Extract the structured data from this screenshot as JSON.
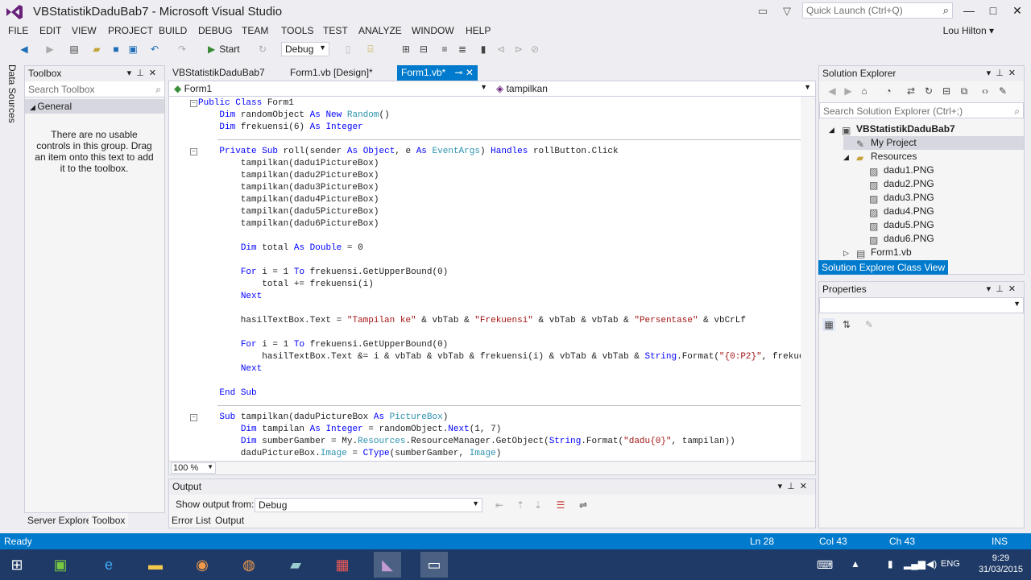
{
  "window": {
    "title": "VBStatistikDaduBab7 - Microsoft Visual Studio",
    "quick_launch_placeholder": "Quick Launch (Ctrl+Q)"
  },
  "menu": [
    "FILE",
    "EDIT",
    "VIEW",
    "PROJECT",
    "BUILD",
    "DEBUG",
    "TEAM",
    "TOOLS",
    "TEST",
    "ANALYZE",
    "WINDOW",
    "HELP"
  ],
  "user": "Lou Hilton",
  "toolbar": {
    "start_label": "Start",
    "config": "Debug"
  },
  "left_strip": {
    "data_sources": "Data Sources"
  },
  "toolbox": {
    "title": "Toolbox",
    "search_placeholder": "Search Toolbox",
    "group": "General",
    "empty_text": "There are no usable controls in this group. Drag an item onto this text to add it to the toolbox."
  },
  "left_bottom_tabs": [
    "Server Explorer",
    "Toolbox"
  ],
  "doc_tabs": [
    "VBStatistikDaduBab7",
    "Form1.vb [Design]*",
    "Form1.vb*"
  ],
  "editor": {
    "nav_left": "Form1",
    "nav_right": "tampilkan",
    "zoom": "100 %",
    "lines": [
      [
        "Public Class Form1"
      ],
      [
        "    Dim randomObject As New Random()"
      ],
      [
        "    Dim frekuensi(6) As Integer"
      ],
      [
        ""
      ],
      [
        "    Private Sub roll(sender As Object, e As EventArgs) Handles rollButton.Click"
      ],
      [
        "        tampilkan(dadu1PictureBox)"
      ],
      [
        "        tampilkan(dadu2PictureBox)"
      ],
      [
        "        tampilkan(dadu3PictureBox)"
      ],
      [
        "        tampilkan(dadu4PictureBox)"
      ],
      [
        "        tampilkan(dadu5PictureBox)"
      ],
      [
        "        tampilkan(dadu6PictureBox)"
      ],
      [
        ""
      ],
      [
        "        Dim total As Double = 0"
      ],
      [
        ""
      ],
      [
        "        For i = 1 To frekuensi.GetUpperBound(0)"
      ],
      [
        "            total += frekuensi(i)"
      ],
      [
        "        Next"
      ],
      [
        ""
      ],
      [
        "        hasilTextBox.Text = \"Tampilan ke\" & vbTab & \"Frekuensi\" & vbTab & vbTab & \"Persentase\" & vbCrLf"
      ],
      [
        ""
      ],
      [
        "        For i = 1 To frekuensi.GetUpperBound(0)"
      ],
      [
        "            hasilTextBox.Text &= i & vbTab & vbTab & frekuensi(i) & vbTab & vbTab & String.Format(\"{0:P2}\", frekue"
      ],
      [
        "        Next"
      ],
      [
        ""
      ],
      [
        "    End Sub"
      ],
      [
        ""
      ],
      [
        "    Sub tampilkan(daduPictureBox As PictureBox)"
      ],
      [
        "        Dim tampilan As Integer = randomObject.Next(1, 7)"
      ],
      [
        "        Dim sumberGamber = My.Resources.ResourceManager.GetObject(String.Format(\"dadu{0}\", tampilan))"
      ],
      [
        "        daduPictureBox.Image = CType(sumberGamber, Image)"
      ]
    ]
  },
  "output": {
    "title": "Output",
    "show_from_label": "Show output from:",
    "source": "Debug"
  },
  "center_bottom_tabs": [
    "Error List",
    "Output"
  ],
  "solution_explorer": {
    "title": "Solution Explorer",
    "search_placeholder": "Search Solution Explorer (Ctrl+;)",
    "items": [
      "VBStatistikDaduBab7",
      "My Project",
      "Resources",
      "dadu1.PNG",
      "dadu2.PNG",
      "dadu3.PNG",
      "dadu4.PNG",
      "dadu5.PNG",
      "dadu6.PNG",
      "Form1.vb"
    ]
  },
  "right_tabs": [
    "Solution Explorer",
    "Class View"
  ],
  "properties": {
    "title": "Properties"
  },
  "status": {
    "ready": "Ready",
    "ln": "Ln 28",
    "col": "Col 43",
    "ch": "Ch 43",
    "mode": "INS"
  },
  "taskbar": {
    "lang": "ENG",
    "time": "9:29",
    "date": "31/03/2015"
  }
}
